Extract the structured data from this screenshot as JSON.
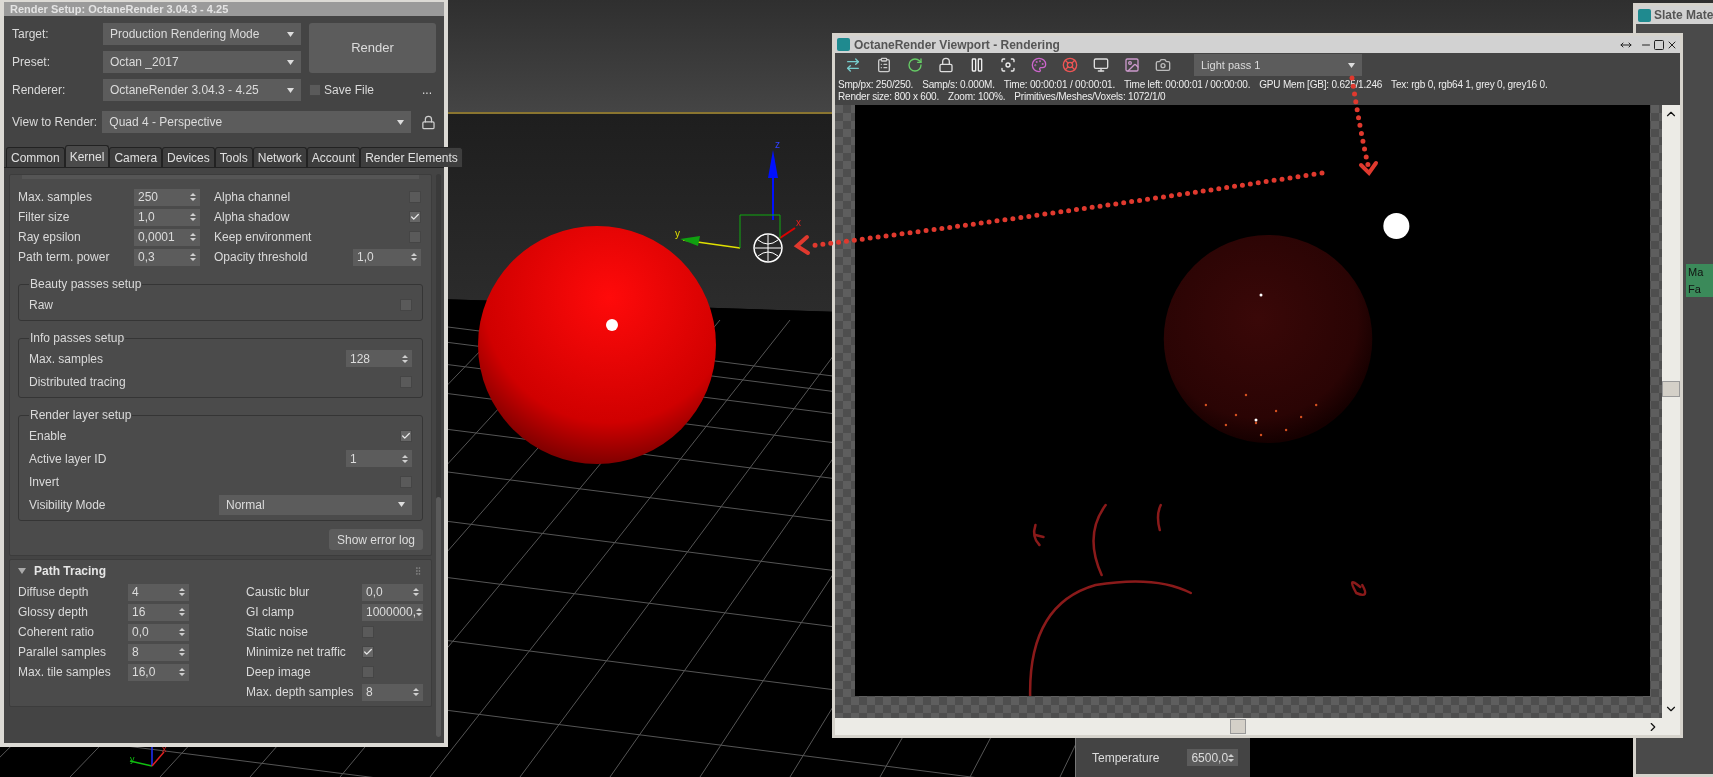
{
  "render_setup": {
    "title": "Render Setup: OctaneRender 3.04.3 - 4.25",
    "fields": [
      {
        "label": "Target:",
        "value": "Production Rendering Mode"
      },
      {
        "label": "Preset:",
        "value": "Octan _2017"
      },
      {
        "label": "Renderer:",
        "value": "OctaneRender 3.04.3 - 4.25"
      }
    ],
    "render_button": "Render",
    "save_file": {
      "label": "Save File",
      "checked": false
    },
    "more_button": "...",
    "view_to_render": {
      "label": "View to Render:",
      "value": "Quad 4 - Perspective"
    },
    "tabs": [
      {
        "label": "Common",
        "selected": false
      },
      {
        "label": "Kernel",
        "selected": true
      },
      {
        "label": "Camera",
        "selected": false
      },
      {
        "label": "Devices",
        "selected": false
      },
      {
        "label": "Tools",
        "selected": false
      },
      {
        "label": "Network",
        "selected": false
      },
      {
        "label": "Account",
        "selected": false
      },
      {
        "label": "Render Elements",
        "selected": false
      }
    ],
    "kernel_left": [
      {
        "kind": "spinner",
        "label": "Max. samples",
        "value": "250"
      },
      {
        "kind": "spinner",
        "label": "Filter size",
        "value": "1,0"
      },
      {
        "kind": "spinner",
        "label": "Ray epsilon",
        "value": "0,0001"
      },
      {
        "kind": "spinner",
        "label": "Path term. power",
        "value": "0,3"
      }
    ],
    "kernel_right": [
      {
        "kind": "checkbox",
        "label": "Alpha channel",
        "checked": false
      },
      {
        "kind": "checkbox",
        "label": "Alpha shadow",
        "checked": true
      },
      {
        "kind": "checkbox",
        "label": "Keep environment",
        "checked": false
      },
      {
        "kind": "spinner",
        "label": "Opacity threshold",
        "value": "1,0"
      }
    ],
    "groups": [
      {
        "title": "Beauty passes setup",
        "rows": [
          {
            "kind": "checkbox",
            "label": "Raw",
            "checked": false
          }
        ]
      },
      {
        "title": "Info passes setup",
        "rows": [
          {
            "kind": "spinner",
            "label": "Max. samples",
            "value": "128"
          },
          {
            "kind": "checkbox",
            "label": "Distributed tracing",
            "checked": false
          }
        ]
      },
      {
        "title": "Render layer setup",
        "rows": [
          {
            "kind": "checkbox",
            "label": "Enable",
            "checked": true
          },
          {
            "kind": "spinner",
            "label": "Active layer ID",
            "value": "1"
          },
          {
            "kind": "checkbox",
            "label": "Invert",
            "checked": false
          },
          {
            "kind": "dropdown",
            "label": "Visibility Mode",
            "value": "Normal"
          }
        ]
      }
    ],
    "show_error_log": "Show error log",
    "path_tracing": {
      "title": "Path Tracing",
      "expanded": true,
      "left": [
        {
          "kind": "spinner",
          "label": "Diffuse depth",
          "value": "4"
        },
        {
          "kind": "spinner",
          "label": "Glossy depth",
          "value": "16"
        },
        {
          "kind": "spinner",
          "label": "Coherent ratio",
          "value": "0,0"
        },
        {
          "kind": "spinner",
          "label": "Parallel samples",
          "value": "8"
        },
        {
          "kind": "spinner",
          "label": "Max. tile samples",
          "value": "16,0"
        }
      ],
      "right": [
        {
          "kind": "spinner",
          "label": "Caustic blur",
          "value": "0,0"
        },
        {
          "kind": "spinner",
          "label": "GI clamp",
          "value": "1000000,"
        },
        {
          "kind": "checkbox",
          "label": "Static noise",
          "checked": false
        },
        {
          "kind": "checkbox",
          "label": "Minimize net traffic",
          "checked": true
        },
        {
          "kind": "checkbox",
          "label": "Deep image",
          "checked": false
        },
        {
          "kind": "spinner",
          "label": "Max. depth samples",
          "value": "8"
        }
      ]
    }
  },
  "scene": {
    "gizmo_axes": [
      "z",
      "y",
      "x"
    ],
    "corner_axes": [
      "y",
      "x"
    ]
  },
  "viewport_window": {
    "title": "OctaneRender Viewport - Rendering",
    "pass_dropdown": "Light pass 1",
    "stats": [
      [
        "Smp/px: 250/250.",
        "Samp/s: 0.000M.",
        "Time: 00:00:01 / 00:00:01.",
        "Time left: 00:00:01 / 00:00:00.",
        "GPU Mem [GB]: 0.625/1.246",
        "Tex: rgb 0, rgb64 1, grey 0, grey16 0."
      ],
      [
        "Render size: 800 x 600.",
        "Zoom: 100%.",
        "Primitives/Meshes/Voxels: 1072/1/0"
      ]
    ]
  },
  "bottom_panel": {
    "label": "Temperature",
    "value": "6500,0"
  },
  "slate_window": {
    "title": "Slate Mate",
    "node_lines": [
      "Ma",
      "Fa"
    ]
  }
}
